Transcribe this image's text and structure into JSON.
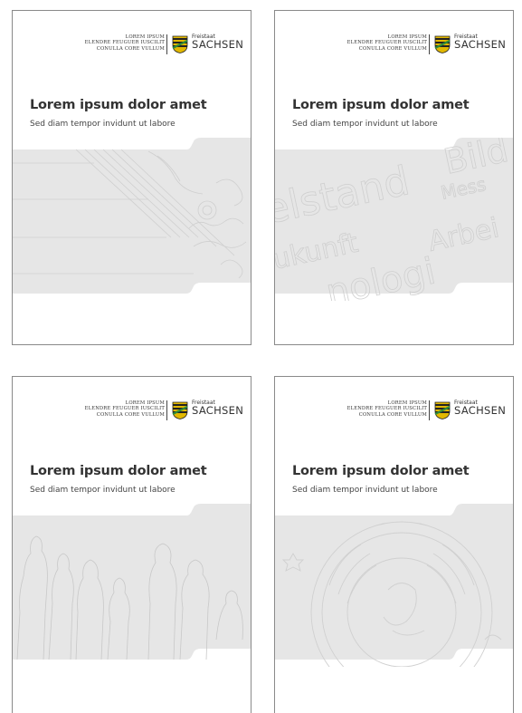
{
  "pages": [
    {
      "sender": [
        "LOREM IPSUM",
        "ELENDRE FEUGUER IUSCILIT",
        "CONULLA CORE VULLUM"
      ],
      "brand_small": "Freistaat",
      "brand_big": "SACHSEN",
      "title": "Lorem ipsum dolor amet",
      "subtitle": "Sed diam tempor invidunt ut labore",
      "pattern": "ornament-lines"
    },
    {
      "sender": [
        "LOREM IPSUM",
        "ELENDRE FEUGUER IUSCILIT",
        "CONULLA CORE VULLUM"
      ],
      "brand_small": "Freistaat",
      "brand_big": "SACHSEN",
      "title": "Lorem ipsum dolor amet",
      "subtitle": "Sed diam tempor invidunt ut labore",
      "pattern": "word-collage"
    },
    {
      "sender": [
        "LOREM IPSUM",
        "ELENDRE FEUGUER IUSCILIT",
        "CONULLA CORE VULLUM"
      ],
      "brand_small": "Freistaat",
      "brand_big": "SACHSEN",
      "title": "Lorem ipsum dolor amet",
      "subtitle": "Sed diam tempor invidunt ut labore",
      "pattern": "people-silhouettes"
    },
    {
      "sender": [
        "LOREM IPSUM",
        "ELENDRE FEUGUER IUSCILIT",
        "CONULLA CORE VULLUM"
      ],
      "brand_small": "Freistaat",
      "brand_big": "SACHSEN",
      "title": "Lorem ipsum dolor amet",
      "subtitle": "Sed diam tempor invidunt ut labore",
      "pattern": "seal-emblem"
    }
  ],
  "word_collage": [
    "Bild",
    "elstand",
    "Mess",
    "ukunft",
    "Arbei",
    "nologi"
  ],
  "colors": {
    "band": "#e6e6e6",
    "band_line": "#cfcfcf",
    "text": "#333333",
    "border": "#8a8a8a",
    "crest_gold": "#e2b800",
    "crest_black": "#222222",
    "crest_green": "#2f8a3a"
  }
}
